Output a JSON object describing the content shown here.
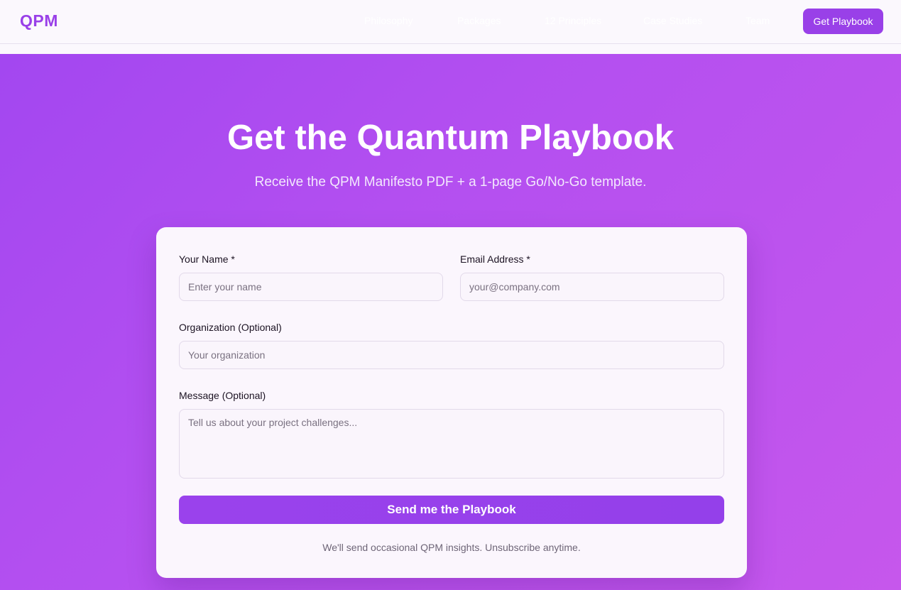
{
  "header": {
    "logo": "QPM",
    "nav": [
      {
        "label": "Philosophy"
      },
      {
        "label": "Packages"
      },
      {
        "label": "12 Principles"
      },
      {
        "label": "Case Studies"
      },
      {
        "label": "Team"
      }
    ],
    "cta_label": "Get Playbook"
  },
  "hero": {
    "title": "Get the Quantum Playbook",
    "subtitle": "Receive the QPM Manifesto PDF + a 1-page Go/No-Go template."
  },
  "form": {
    "name_label": "Your Name *",
    "name_placeholder": "Enter your name",
    "email_label": "Email Address *",
    "email_placeholder": "your@company.com",
    "org_label": "Organization (Optional)",
    "org_placeholder": "Your organization",
    "message_label": "Message (Optional)",
    "message_placeholder": "Tell us about your project challenges...",
    "submit_label": "Send me the Playbook",
    "note": "We'll send occasional QPM insights. Unsubscribe anytime."
  },
  "colors": {
    "brand": "#9940e8",
    "gradient_start": "#a146f0",
    "gradient_end": "#c657ec",
    "card_bg": "#fbf6fd"
  }
}
